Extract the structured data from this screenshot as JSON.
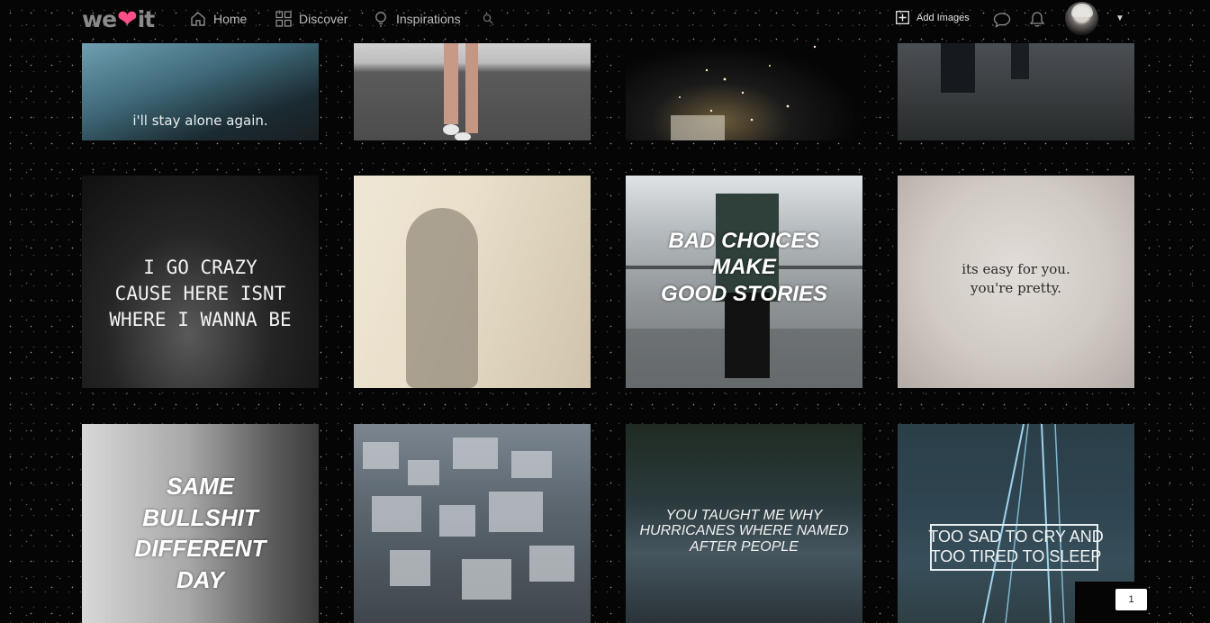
{
  "brand": {
    "logo_left": "we",
    "logo_heart": "❤",
    "logo_right": "it"
  },
  "nav": {
    "home": "Home",
    "discover": "Discover",
    "inspirations": "Inspirations",
    "add_images": "Add Images"
  },
  "tiles": [
    {
      "caption": "i'll stay alone again."
    },
    {
      "caption": ""
    },
    {
      "caption": ""
    },
    {
      "caption": ""
    },
    {
      "caption_lines": [
        "I GO CRAZY",
        "CAUSE HERE ISNT",
        "WHERE I WANNA BE"
      ]
    },
    {
      "caption": ""
    },
    {
      "caption_lines": [
        "BAD CHOICES",
        "MAKE",
        "GOOD STORIES"
      ]
    },
    {
      "caption_lines": [
        "its easy for you.",
        "you're pretty."
      ]
    },
    {
      "caption_lines": [
        "SAME",
        "BULLSHIT",
        "DIFFERENT",
        "DAY"
      ]
    },
    {
      "caption": ""
    },
    {
      "caption_lines": [
        "YOU TAUGHT ME WHY",
        "HURRICANES WHERE NAMED",
        "AFTER PEOPLE"
      ]
    },
    {
      "caption_lines": [
        "TOO SAD TO CRY AND",
        "TOO TIRED TO SLEEP"
      ]
    }
  ],
  "pager": {
    "page": "1"
  },
  "colors": {
    "brand_heart": "#ff4f87",
    "background": "#050505"
  },
  "icons": [
    "home-icon",
    "discover-grid-icon",
    "lightbulb-icon",
    "search-icon",
    "plus-square-icon",
    "chat-icon",
    "bell-icon",
    "caret-down-icon"
  ]
}
